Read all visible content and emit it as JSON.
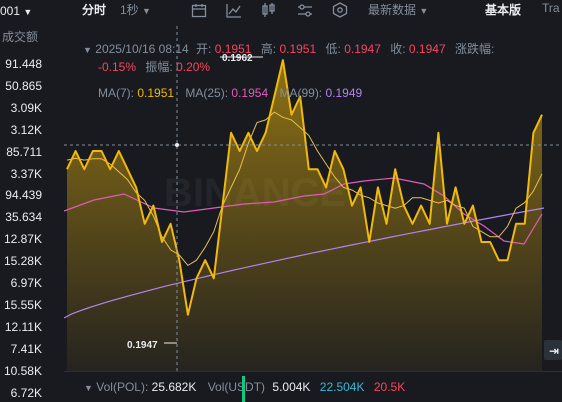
{
  "left_panel": {
    "header": "001",
    "subheader": "成交额",
    "rows": [
      "91.448",
      "50.865",
      "3.09K",
      "3.12K",
      "85.711",
      "3.37K",
      "94.439",
      "35.634",
      "12.87K",
      "15.28K",
      "6.97K",
      "15.55K",
      "12.11K",
      "7.41K",
      "10.58K",
      "6.72K"
    ]
  },
  "toolbar": {
    "timeshare": "分时",
    "interval": "1秒",
    "latest_data": "最新数据",
    "basic": "基本版",
    "trading": "Tra"
  },
  "ohlc": {
    "date": "2025/10/16 08:14",
    "open_label": "开:",
    "open": "0.1951",
    "high_label": "高:",
    "high": "0.1951",
    "low_label": "低:",
    "low": "0.1947",
    "close_label": "收:",
    "close": "0.1947",
    "change_label": "涨跌幅:",
    "change": "-0.15%",
    "amp_label": "振幅:",
    "amp": "0.20%"
  },
  "ma": {
    "ma7_label": "MA(7):",
    "ma7": "0.1951",
    "ma25_label": "MA(25):",
    "ma25": "0.1954",
    "ma99_label": "MA(99):",
    "ma99": "0.1949"
  },
  "annotations": {
    "high_mark": "0.1962",
    "low_mark": "0.1947"
  },
  "watermark": "BINANCE",
  "volume": {
    "vol_pol_label": "Vol(POL):",
    "vol_pol": "25.682K",
    "vol_usdt_label": "Vol(USDT)",
    "vol_usdt": "5.004K",
    "ma1": "22.504K",
    "ma2": "20.5K"
  },
  "colors": {
    "price": "#f0b90b",
    "ma25": "#e15cba",
    "ma99": "#b084ee",
    "down": "#f6465d",
    "up": "#0ecb81"
  },
  "chart_data": {
    "type": "area",
    "series": [
      {
        "name": "MA(7)",
        "values": [
          0.1956,
          0.1957,
          0.1956,
          0.1957,
          0.1957,
          0.1956,
          0.1957,
          0.1956,
          0.1955,
          0.1953,
          0.1954,
          0.1952,
          0.1953,
          0.1951,
          0.1948,
          0.195,
          0.1951,
          0.195,
          0.1954,
          0.1958,
          0.1957,
          0.1958,
          0.1957,
          0.1958,
          0.196,
          0.1962,
          0.1959,
          0.196,
          0.1956,
          0.1956,
          0.1955,
          0.1957,
          0.1956,
          0.1954,
          0.1955,
          0.1952,
          0.1955,
          0.1953,
          0.1956,
          0.1954,
          0.1953,
          0.1954,
          0.1953,
          0.1958,
          0.1953,
          0.1955,
          0.1953,
          0.1954,
          0.1952,
          0.1952,
          0.1951,
          0.1951,
          0.1953,
          0.1953,
          0.1958,
          0.1959
        ]
      },
      {
        "name": "MA(25)",
        "values": []
      },
      {
        "name": "MA(99)",
        "values": []
      }
    ],
    "high": 0.1962,
    "low": 0.1947
  }
}
